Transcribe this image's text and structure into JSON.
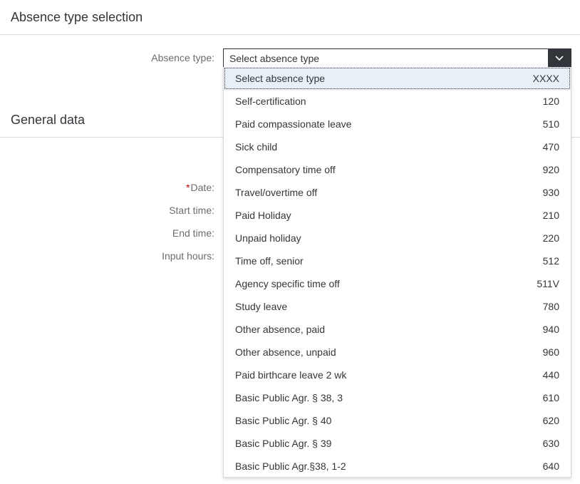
{
  "sections": {
    "absence_selection_title": "Absence type selection",
    "general_data_title": "General data"
  },
  "form": {
    "absence_type_label": "Absence type:",
    "absence_type_value": "Select absence type",
    "date_label": "Date:",
    "date_required_marker": "*",
    "start_time_label": "Start time:",
    "end_time_label": "End time:",
    "input_hours_label": "Input hours:"
  },
  "dropdown": {
    "arrow_icon": "chevron-down-icon",
    "options": [
      {
        "label": "Select absence type",
        "code": "XXXX",
        "selected": true
      },
      {
        "label": "Self-certification",
        "code": "120"
      },
      {
        "label": "Paid compassionate leave",
        "code": "510"
      },
      {
        "label": "Sick child",
        "code": "470"
      },
      {
        "label": "Compensatory time off",
        "code": "920"
      },
      {
        "label": "Travel/overtime off",
        "code": "930"
      },
      {
        "label": "Paid Holiday",
        "code": "210"
      },
      {
        "label": "Unpaid holiday",
        "code": "220"
      },
      {
        "label": "Time off, senior",
        "code": "512"
      },
      {
        "label": "Agency specific time off",
        "code": "511V"
      },
      {
        "label": "Study leave",
        "code": "780"
      },
      {
        "label": "Other absence, paid",
        "code": "940"
      },
      {
        "label": "Other absence, unpaid",
        "code": "960"
      },
      {
        "label": "Paid birthcare leave 2 wk",
        "code": "440"
      },
      {
        "label": "Basic Public Agr. § 38, 3",
        "code": "610"
      },
      {
        "label": "Basic Public Agr. § 40",
        "code": "620"
      },
      {
        "label": "Basic Public Agr. § 39",
        "code": "630"
      },
      {
        "label": "Basic Public Agr.§38, 1-2",
        "code": "640"
      }
    ]
  },
  "colors": {
    "text": "#32363a",
    "label": "#6a6d70",
    "required": "#bb0000",
    "selected_bg": "#e8eff6",
    "arrow_bg": "#32363a"
  }
}
